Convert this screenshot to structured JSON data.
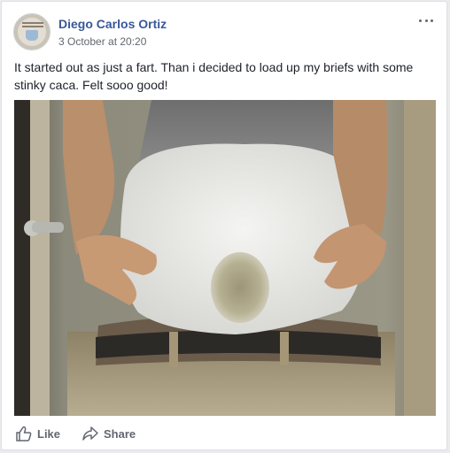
{
  "post": {
    "author": "Diego Carlos Ortiz",
    "timestamp": "3 October at 20:20",
    "message": "It started out as just a fart. Than i decided to load up my briefs with some stinky caca. Felt sooo good!",
    "photo_icon": "post-photo",
    "avatar_icon": "profile-avatar"
  },
  "actions": {
    "like_label": "Like",
    "share_label": "Share"
  },
  "colors": {
    "author_link": "#385898",
    "meta_text": "#616770",
    "body_text": "#1d2129",
    "action_text": "#606770"
  }
}
